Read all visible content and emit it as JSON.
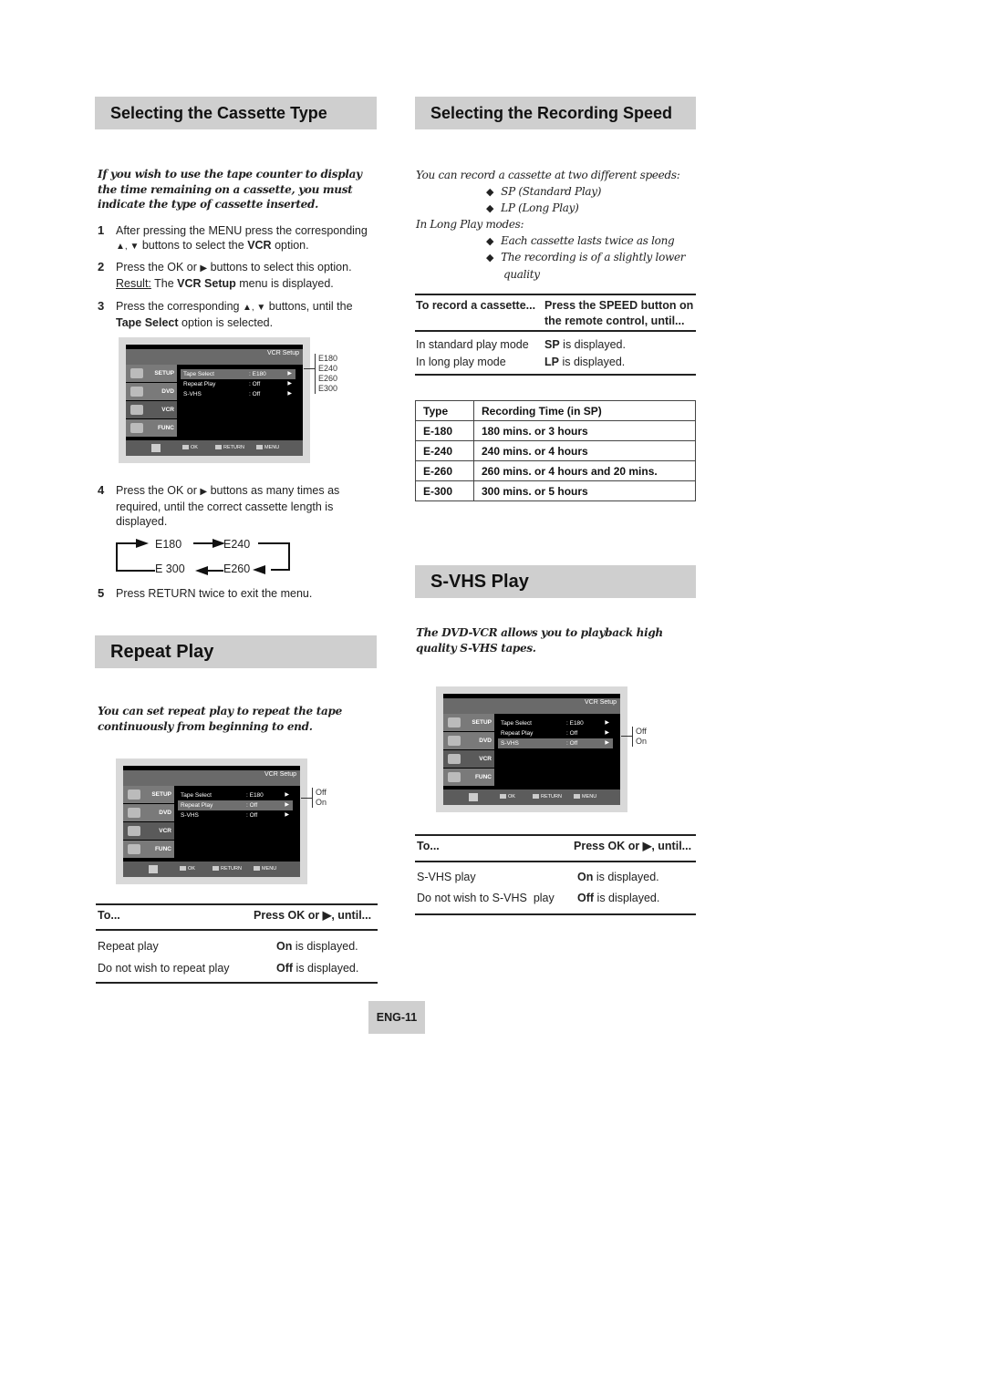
{
  "left": {
    "cassette": {
      "heading": "Selecting the Cassette Type",
      "intro": "If you wish to use the tape counter to display the time remaining on a cassette, you must indicate the type of cassette inserted.",
      "steps": [
        {
          "num": "1",
          "pre": "After pressing the MENU press the corresponding ",
          "tri": "▲, ▼",
          "mid": " buttons to select the ",
          "bold": "VCR",
          "post": " option."
        },
        {
          "num": "2",
          "pre": "Press the OK or ",
          "tri": "▶",
          "mid": " buttons to select this option.",
          "result_label": "Result:",
          "result_pre": " The ",
          "result_bold": "VCR Setup",
          "result_post": " menu is displayed."
        },
        {
          "num": "3",
          "pre": "Press the corresponding ",
          "tri": "▲, ▼",
          "mid": " buttons, until the ",
          "bold": "Tape Select",
          "post": " option is selected."
        },
        {
          "num": "4",
          "pre": "Press the OK or ",
          "tri": "▶",
          "mid": " buttons as many times as required, until the correct cassette length is displayed."
        },
        {
          "num": "5",
          "pre": "Press RETURN twice to exit the menu."
        }
      ],
      "cycle": [
        "E180",
        "E240",
        "E260",
        "E 300"
      ],
      "osd_options": [
        "E180",
        "E240",
        "E260",
        "E300"
      ]
    },
    "repeat": {
      "heading": "Repeat Play",
      "intro": "You can set repeat play to repeat the tape continuously from beginning to end.",
      "osd_options": [
        "Off",
        "On"
      ],
      "table": {
        "col1": "To...",
        "col2": "Press OK or ▶, until...",
        "rows": [
          {
            "action": "Repeat play",
            "value_bold": "On",
            "value_rest": " is displayed."
          },
          {
            "action": "Do not wish to repeat play",
            "value_bold": "Off",
            "value_rest": " is displayed."
          }
        ]
      }
    }
  },
  "osd": {
    "title": "VCR Setup",
    "tabs": [
      "SETUP",
      "DVD",
      "VCR",
      "FUNC"
    ],
    "rows": [
      {
        "label": "Tape Select",
        "value": ": E180",
        "arrow": "▶"
      },
      {
        "label": "Repeat Play",
        "value": ": Off",
        "arrow": "▶"
      },
      {
        "label": "S-VHS",
        "value": ": Off",
        "arrow": "▶"
      }
    ],
    "footer": {
      "ok": "OK",
      "return": "RETURN",
      "menu": "MENU"
    }
  },
  "right": {
    "speed": {
      "heading": "Selecting the Recording Speed",
      "intro": "You can record a cassette at two different speeds:",
      "speeds": [
        "SP (Standard Play)",
        "LP (Long Play)"
      ],
      "lp_label": "In Long Play modes:",
      "lp_points": [
        "Each cassette lasts twice as long",
        "The recording is of a slightly lower",
        "quality"
      ],
      "table": {
        "col1": "To record a cassette...",
        "col2_line1": "Press the SPEED button on",
        "col2_line2": "the remote control, until...",
        "rows": [
          {
            "action": "In standard play mode",
            "value_bold": "SP",
            "value_rest": " is displayed."
          },
          {
            "action": "In long play mode",
            "value_bold": "LP",
            "value_rest": " is displayed."
          }
        ]
      },
      "time_table": {
        "headers": [
          "Type",
          "Recording Time (in SP)"
        ],
        "rows": [
          [
            "E-180",
            "180 mins. or 3 hours"
          ],
          [
            "E-240",
            "240 mins. or 4 hours"
          ],
          [
            "E-260",
            "260 mins. or 4 hours and 20 mins."
          ],
          [
            "E-300",
            "300 mins. or 5 hours"
          ]
        ]
      }
    },
    "svhs": {
      "heading": "S-VHS Play",
      "intro": "The DVD-VCR allows you to playback high quality S-VHS tapes.",
      "osd_options": [
        "Off",
        "On"
      ],
      "table": {
        "col1": "To...",
        "col2": "Press OK or ▶, until...",
        "rows": [
          {
            "action": "S-VHS play",
            "value_bold": "On",
            "value_rest": " is displayed."
          },
          {
            "action": "Do not wish to S-VHS  play",
            "value_bold": "Off",
            "value_rest": " is displayed."
          }
        ]
      }
    }
  },
  "page_number": "ENG-11"
}
